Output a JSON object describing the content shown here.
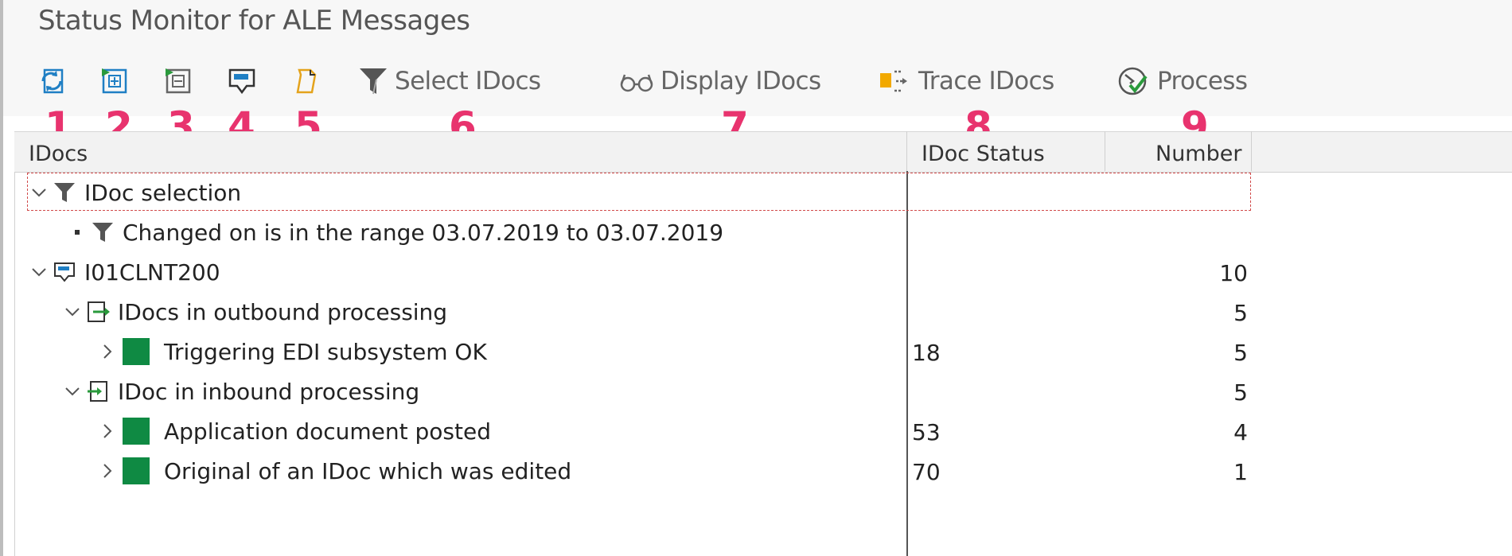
{
  "window": {
    "title": "Status Monitor for ALE Messages"
  },
  "toolbar": {
    "icons": [
      {
        "name": "refresh-icon",
        "number": "1"
      },
      {
        "name": "expand-subtree-icon",
        "number": "2"
      },
      {
        "name": "collapse-subtree-icon",
        "number": "3"
      },
      {
        "name": "idoc-icon",
        "number": "4"
      },
      {
        "name": "document-icon",
        "number": "5"
      }
    ],
    "select_label": "Select IDocs",
    "select_number": "6",
    "display_label": "Display IDocs",
    "display_number": "7",
    "trace_label": "Trace IDocs",
    "trace_number": "8",
    "process_label": "Process",
    "process_number": "9"
  },
  "table": {
    "headers": {
      "idocs": "IDocs",
      "status": "IDoc Status",
      "number": "Number"
    },
    "rows": [
      {
        "label": "IDoc selection",
        "status": "",
        "number": ""
      },
      {
        "label": "Changed on is in the range 03.07.2019 to 03.07.2019",
        "status": "",
        "number": ""
      },
      {
        "label": "I01CLNT200",
        "status": "",
        "number": "10"
      },
      {
        "label": "IDocs in outbound processing",
        "status": "",
        "number": "5"
      },
      {
        "label": "Triggering EDI subsystem OK",
        "status": "18",
        "number": "5"
      },
      {
        "label": "IDoc in inbound processing",
        "status": "",
        "number": "5"
      },
      {
        "label": "Application document posted",
        "status": "53",
        "number": "4"
      },
      {
        "label": "Original of an IDoc which was edited",
        "status": "70",
        "number": "1"
      }
    ]
  },
  "colors": {
    "annotation": "#e8336e",
    "status_green": "#0f8a43",
    "selection_border": "#d14a4a"
  }
}
